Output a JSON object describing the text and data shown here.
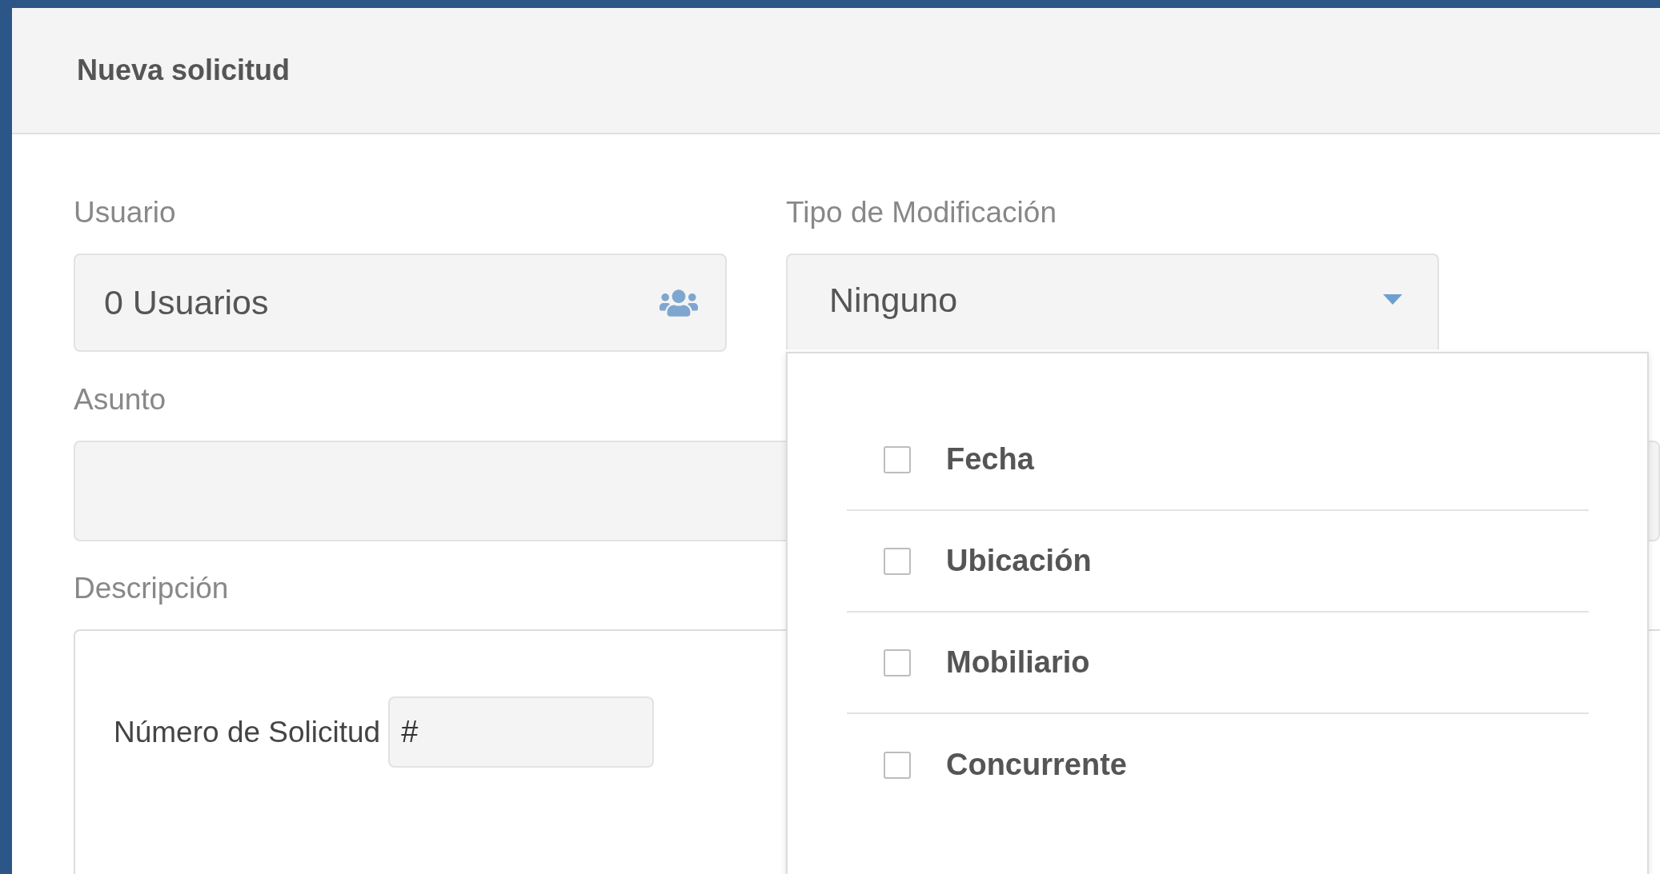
{
  "header": {
    "title": "Nueva solicitud"
  },
  "user": {
    "label": "Usuario",
    "value": "0 Usuarios"
  },
  "modification": {
    "label": "Tipo de Modificación",
    "value": "Ninguno",
    "open": true,
    "options": [
      {
        "label": "Fecha",
        "checked": false
      },
      {
        "label": "Ubicación",
        "checked": false
      },
      {
        "label": "Mobiliario",
        "checked": false
      },
      {
        "label": "Concurrente",
        "checked": false
      }
    ]
  },
  "subject": {
    "label": "Asunto"
  },
  "description": {
    "label": "Descripción",
    "request_number": {
      "label": "Número de Solicitud",
      "value": "#"
    }
  }
}
